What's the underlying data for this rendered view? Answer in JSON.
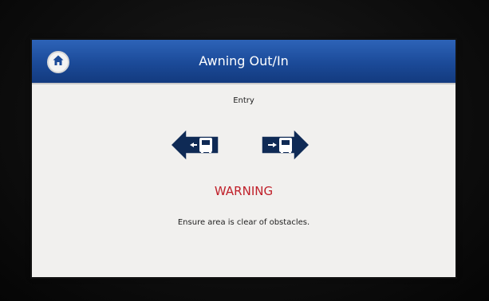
{
  "window": {
    "title": "Awning Out/In"
  },
  "toolbar": {
    "home_icon": "home-icon"
  },
  "panel": {
    "subtitle": "Entry",
    "left_button_icon": "arrow-left-icon",
    "right_button_icon": "arrow-right-icon",
    "warning": "WARNING",
    "message": "Ensure area is clear of obstacles."
  },
  "colors": {
    "titlebar": "#1b4a98",
    "warning": "#c0202a",
    "arrow_fill": "#0f2a55"
  }
}
